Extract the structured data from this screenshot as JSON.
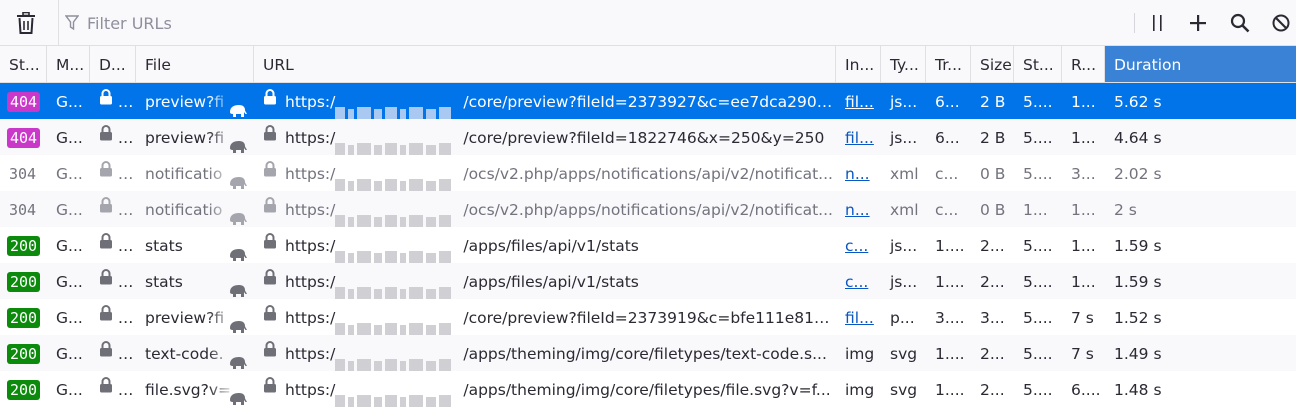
{
  "toolbar": {
    "clear_icon": "trash-icon",
    "filter_placeholder": "Filter URLs",
    "filter_icon": "funnel-icon",
    "actions": [
      "pause-icon",
      "plus-icon",
      "search-icon",
      "block-icon"
    ]
  },
  "columns": [
    {
      "key": "status",
      "label": "St..."
    },
    {
      "key": "method",
      "label": "M..."
    },
    {
      "key": "domain",
      "label": "D..."
    },
    {
      "key": "file",
      "label": "File"
    },
    {
      "key": "url",
      "label": "URL"
    },
    {
      "key": "initiator",
      "label": "In..."
    },
    {
      "key": "type",
      "label": "Ty..."
    },
    {
      "key": "transferred",
      "label": "Tr..."
    },
    {
      "key": "size",
      "label": "Size"
    },
    {
      "key": "start",
      "label": "St..."
    },
    {
      "key": "response",
      "label": "R..."
    },
    {
      "key": "duration",
      "label": "Duration",
      "sorted": true
    }
  ],
  "rows": [
    {
      "status": "404",
      "method": "G...",
      "file": "preview?fi",
      "url_prefix": "https:/",
      "url_path": "/core/preview?fileId=2373927&c=ee7dca290d...",
      "initiator": "fil...",
      "initiator_link": true,
      "type": "js...",
      "transferred": "6...",
      "size": "2 B",
      "start": "5....",
      "response": "1...",
      "duration": "5.62 s",
      "selected": true,
      "dim": false
    },
    {
      "status": "404",
      "method": "G...",
      "file": "preview?fi",
      "url_prefix": "https:/",
      "url_path": "/core/preview?fileId=1822746&x=250&y=250",
      "initiator": "fil...",
      "initiator_link": true,
      "type": "js...",
      "transferred": "6...",
      "size": "2 B",
      "start": "5....",
      "response": "1...",
      "duration": "4.64 s",
      "selected": false,
      "dim": false
    },
    {
      "status": "304",
      "method": "G...",
      "file": "notificatio",
      "url_prefix": "https:/",
      "url_path": "/ocs/v2.php/apps/notifications/api/v2/notificat...",
      "initiator": "n...",
      "initiator_link": true,
      "type": "xml",
      "transferred": "c...",
      "size": "0 B",
      "start": "5....",
      "response": "3...",
      "duration": "2.02 s",
      "selected": false,
      "dim": true
    },
    {
      "status": "304",
      "method": "G...",
      "file": "notificatio",
      "url_prefix": "https:/",
      "url_path": "/ocs/v2.php/apps/notifications/api/v2/notificat...",
      "initiator": "n...",
      "initiator_link": true,
      "type": "xml",
      "transferred": "c...",
      "size": "0 B",
      "start": "1...",
      "response": "1...",
      "duration": "2 s",
      "selected": false,
      "dim": true
    },
    {
      "status": "200",
      "method": "G...",
      "file": "stats",
      "url_prefix": "https:/",
      "url_path": "/apps/files/api/v1/stats",
      "initiator": "c...",
      "initiator_link": true,
      "type": "js...",
      "transferred": "1....",
      "size": "2...",
      "start": "5....",
      "response": "1...",
      "duration": "1.59 s",
      "selected": false,
      "dim": false
    },
    {
      "status": "200",
      "method": "G...",
      "file": "stats",
      "url_prefix": "https:/",
      "url_path": "/apps/files/api/v1/stats",
      "initiator": "c...",
      "initiator_link": true,
      "type": "js...",
      "transferred": "1....",
      "size": "2...",
      "start": "5....",
      "response": "1...",
      "duration": "1.59 s",
      "selected": false,
      "dim": false
    },
    {
      "status": "200",
      "method": "G...",
      "file": "preview?fi",
      "url_prefix": "https:/",
      "url_path": "/core/preview?fileId=2373919&c=bfe111e811c...",
      "initiator": "fil...",
      "initiator_link": true,
      "type": "p...",
      "transferred": "3....",
      "size": "3...",
      "start": "5....",
      "response": "7 s",
      "duration": "1.52 s",
      "selected": false,
      "dim": false
    },
    {
      "status": "200",
      "method": "G...",
      "file": "text-code.",
      "url_prefix": "https:/",
      "url_path": "/apps/theming/img/core/filetypes/text-code.s...",
      "initiator": "img",
      "initiator_link": false,
      "type": "svg",
      "transferred": "1....",
      "size": "2...",
      "start": "5....",
      "response": "7 s",
      "duration": "1.49 s",
      "selected": false,
      "dim": false
    },
    {
      "status": "200",
      "method": "G...",
      "file": "file.svg?v=",
      "url_prefix": "https:/",
      "url_path": "/apps/theming/img/core/filetypes/file.svg?v=f...",
      "initiator": "img",
      "initiator_link": false,
      "type": "svg",
      "transferred": "1....",
      "size": "2...",
      "start": "5....",
      "response": "6....",
      "duration": "1.48 s",
      "selected": false,
      "dim": false
    }
  ]
}
